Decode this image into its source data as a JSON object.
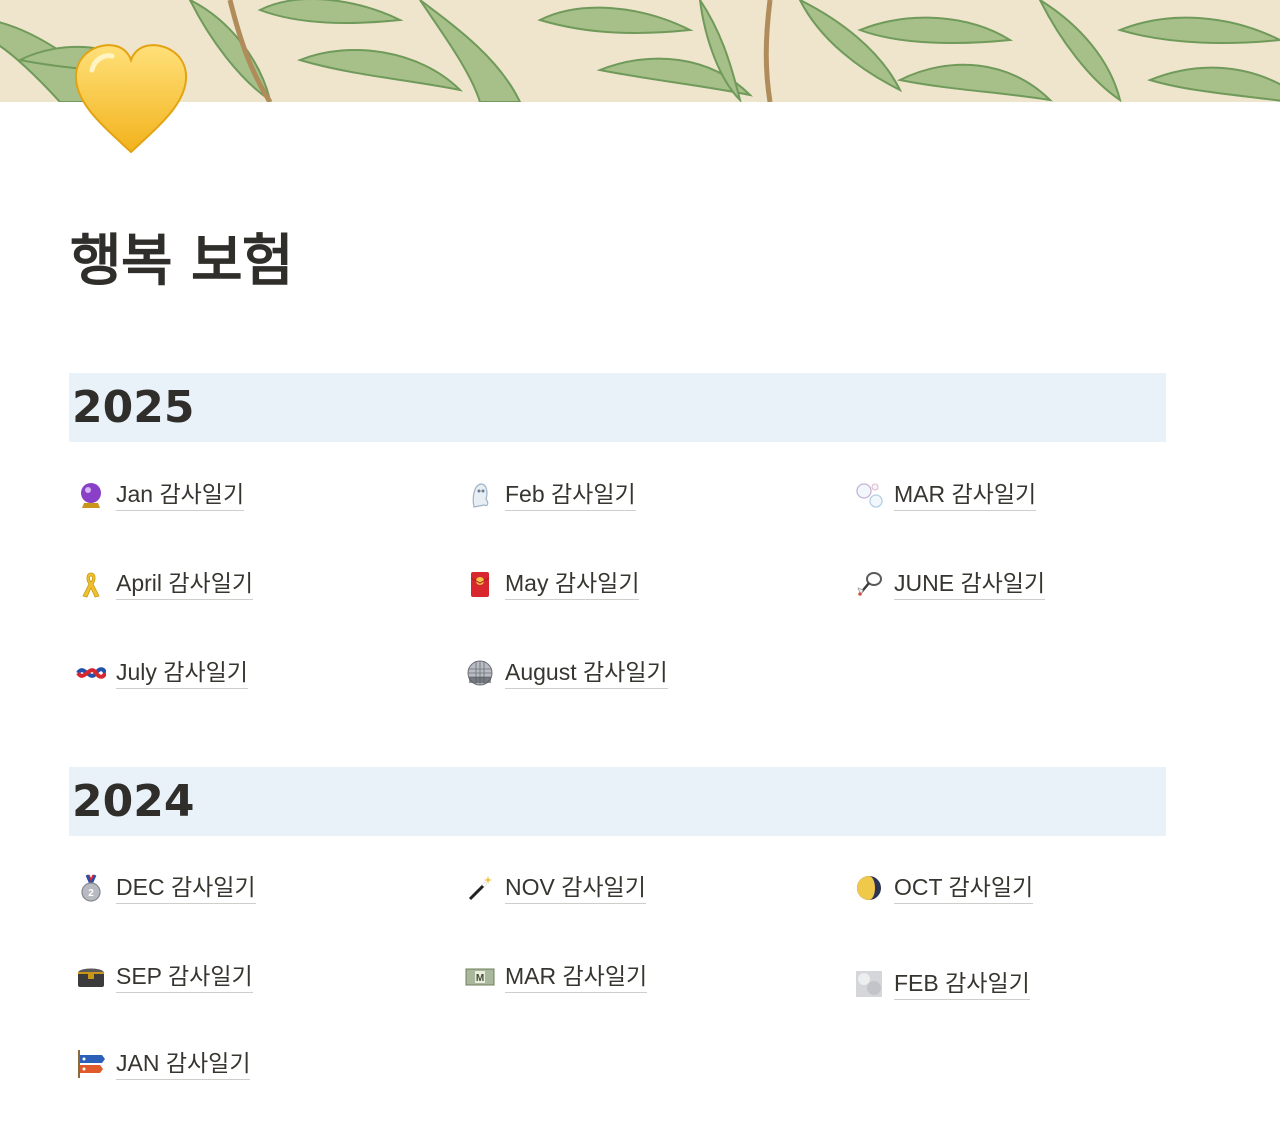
{
  "page": {
    "title": "행복 보험",
    "icon": "yellow-heart-icon",
    "cover_colors": {
      "background": "#efe4cc",
      "leaf_light": "#a7c08a",
      "leaf_dark": "#6f9a5a",
      "stem": "#b08c5a"
    }
  },
  "sections": [
    {
      "heading": "2025",
      "items": [
        {
          "label": "Jan 감사일기",
          "icon": "crystal-ball-icon"
        },
        {
          "label": "Feb 감사일기",
          "icon": "ghost-icon"
        },
        {
          "label": "MAR 감사일기",
          "icon": "bubbles-icon"
        },
        {
          "label": "April 감사일기",
          "icon": "ribbon-icon"
        },
        {
          "label": "May 감사일기",
          "icon": "red-envelope-icon"
        },
        {
          "label": "JUNE 감사일기",
          "icon": "badminton-icon"
        },
        {
          "label": "July 감사일기",
          "icon": "knot-icon"
        },
        {
          "label": "August 감사일기",
          "icon": "mirror-ball-icon"
        }
      ]
    },
    {
      "heading": "2024",
      "items": [
        {
          "label": "DEC 감사일기",
          "icon": "silver-medal-icon"
        },
        {
          "label": "NOV 감사일기",
          "icon": "magic-wand-icon"
        },
        {
          "label": "OCT 감사일기",
          "icon": "moon-icon"
        },
        {
          "label": "SEP 감사일기",
          "icon": "treasure-chest-icon"
        },
        {
          "label": "MAR 감사일기",
          "icon": "money-icon"
        },
        {
          "label": "FEB 감사일기",
          "icon": "gray-square-icon"
        },
        {
          "label": "JAN 감사일기",
          "icon": "carp-streamer-icon"
        }
      ]
    }
  ]
}
